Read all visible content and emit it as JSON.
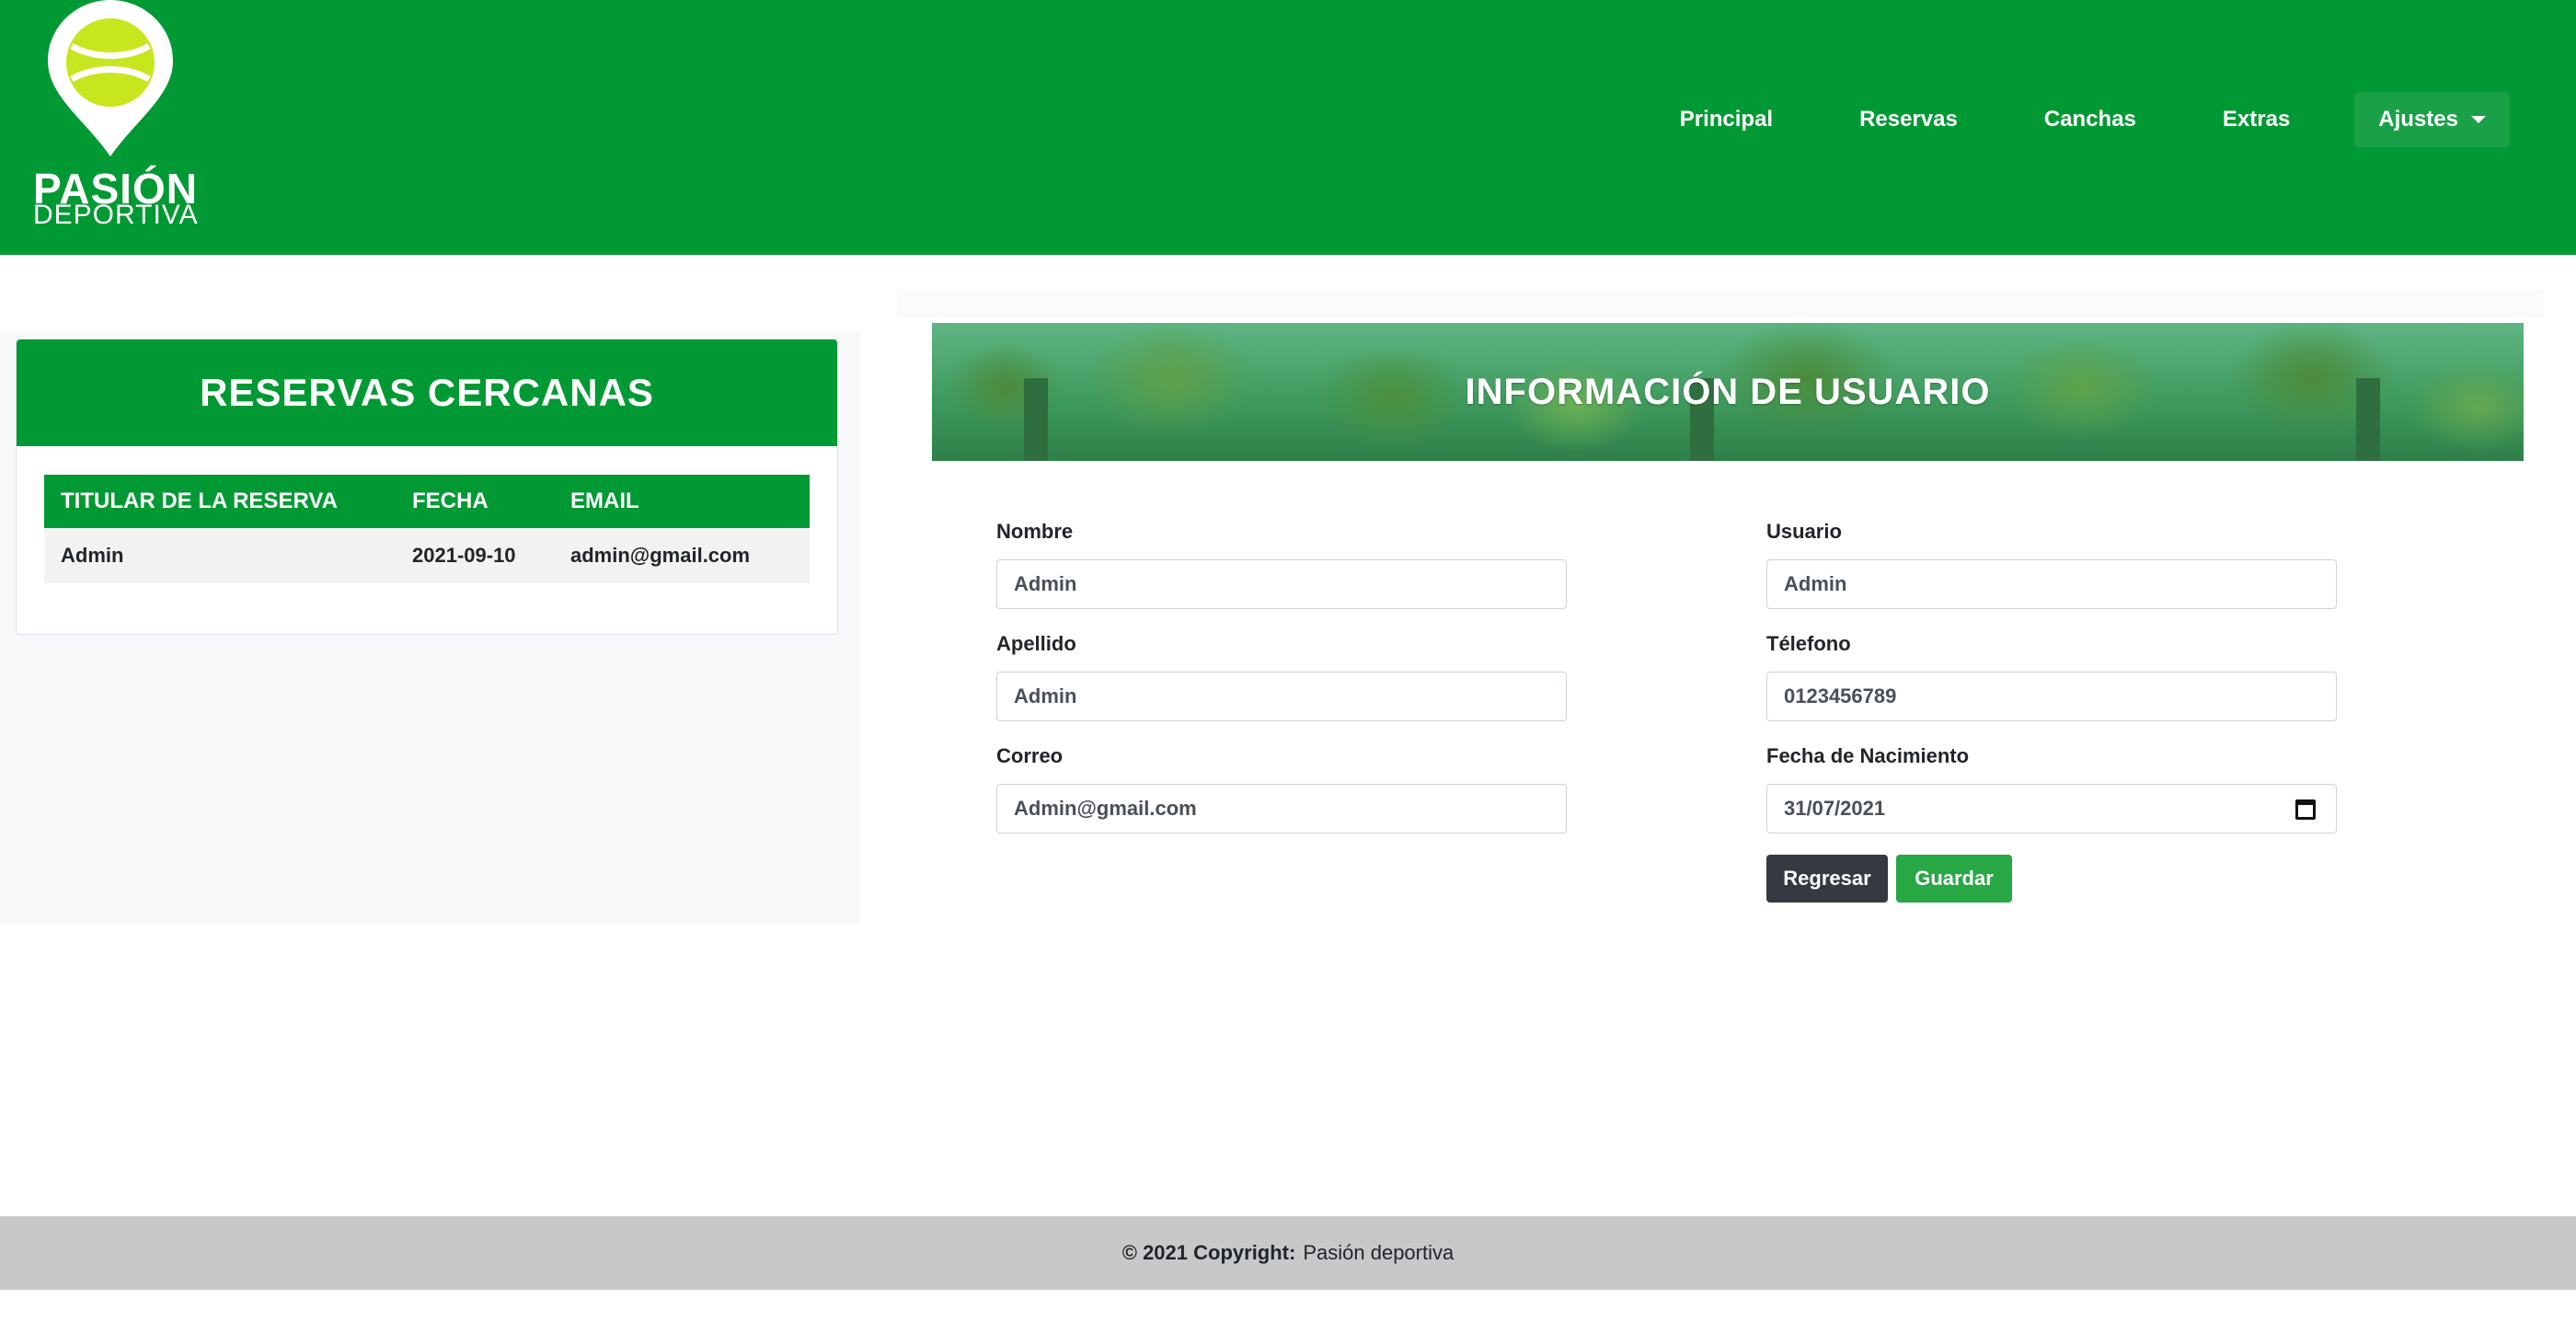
{
  "brand": {
    "line1": "PASIÓN",
    "line2": "DEPORTIVA"
  },
  "nav": {
    "items": [
      {
        "label": "Principal"
      },
      {
        "label": "Reservas"
      },
      {
        "label": "Canchas"
      },
      {
        "label": "Extras"
      }
    ],
    "dropdown_label": "Ajustes"
  },
  "reservations": {
    "title": "RESERVAS CERCANAS",
    "columns": [
      "TITULAR DE LA RESERVA",
      "FECHA",
      "EMAIL"
    ],
    "rows": [
      [
        "Admin",
        "2021-09-10",
        "admin@gmail.com"
      ]
    ]
  },
  "profile": {
    "title": "INFORMACIÓN DE USUARIO",
    "fields": {
      "nombre": {
        "label": "Nombre",
        "value": "Admin"
      },
      "apellido": {
        "label": "Apellido",
        "value": "Admin"
      },
      "correo": {
        "label": "Correo",
        "value": "Admin@gmail.com"
      },
      "usuario": {
        "label": "Usuario",
        "value": "Admin"
      },
      "telefono": {
        "label": "Télefono",
        "value": "0123456789"
      },
      "nacimiento": {
        "label": "Fecha de Nacimiento",
        "value": "31/07/2021"
      }
    },
    "back_label": "Regresar",
    "save_label": "Guardar"
  },
  "footer": {
    "copyright": "© 2021 Copyright:",
    "brand": "Pasión deportiva"
  },
  "colors": {
    "primary": "#009933",
    "lime": "#c8e61e",
    "dark_button": "#343a40",
    "save_button": "#28a745",
    "footer_bg": "#c6c8ca"
  },
  "icons": {
    "logo": "tennis-ball-pin-icon",
    "dropdown": "caret-down-icon",
    "calendar": "calendar-icon"
  }
}
